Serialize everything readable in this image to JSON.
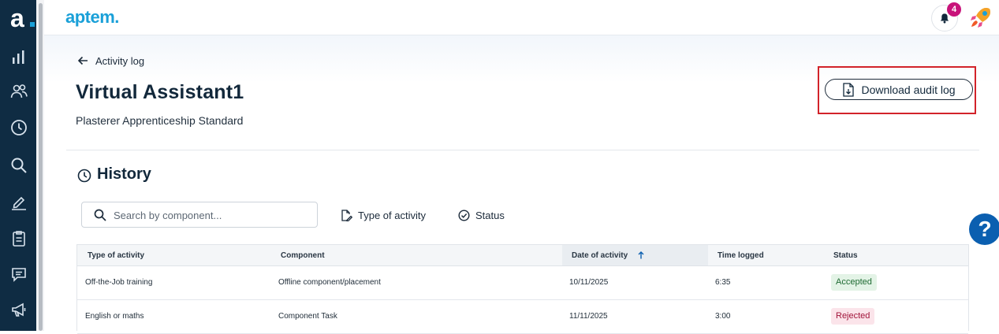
{
  "header": {
    "brand": "aptem.",
    "notification_count": "4"
  },
  "nav": {
    "logo_letter": "a",
    "icons": [
      "reports-icon",
      "people-icon",
      "clock-icon",
      "search-icon",
      "pen-icon",
      "clipboard-icon",
      "chat-icon",
      "megaphone-icon"
    ]
  },
  "page": {
    "back_label": "Activity log",
    "title": "Virtual Assistant1",
    "subtitle": "Plasterer Apprenticeship Standard",
    "download_label": "Download audit log"
  },
  "history": {
    "title": "History",
    "search_placeholder": "Search by component...",
    "filters": {
      "type_label": "Type of activity",
      "status_label": "Status"
    },
    "columns": [
      "Type of activity",
      "Component",
      "Date of activity",
      "Time logged",
      "Status"
    ],
    "sort_column": "Date of activity",
    "sort_direction": "ascending",
    "rows": [
      {
        "type": "Off-the-Job training",
        "component": "Offline component/placement",
        "date": "10/11/2025",
        "time": "6:35",
        "status": "Accepted"
      },
      {
        "type": "English or maths",
        "component": "Component Task",
        "date": "11/11/2025",
        "time": "3:00",
        "status": "Rejected"
      }
    ]
  },
  "help": {
    "label": "?"
  },
  "colors": {
    "nav_bg": "#0f2c43",
    "brand": "#1aa0d8",
    "accent_pink": "#c8137a",
    "highlight_red": "#d2232a",
    "help_blue": "#0b5fb0",
    "accepted_bg": "#e3f3e6",
    "rejected_bg": "#fbe4ea"
  }
}
